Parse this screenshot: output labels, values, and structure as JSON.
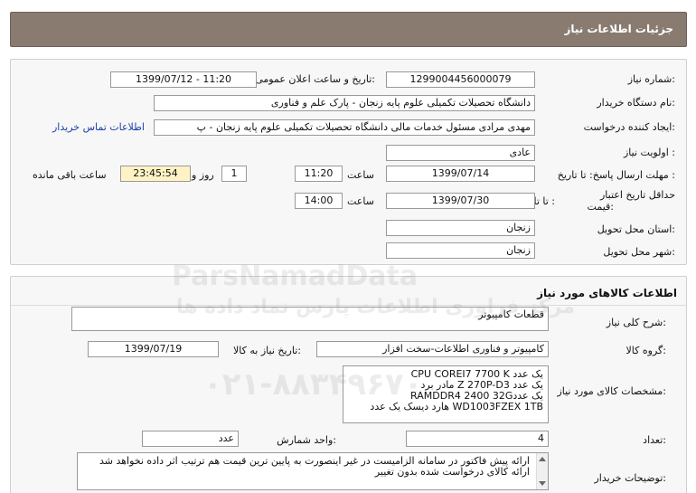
{
  "header": {
    "title": "جزئیات اطلاعات نیاز"
  },
  "form": {
    "need_number_label": "شماره نیاز:",
    "need_number": "1299004456000079",
    "announce_label": "تاریخ و ساعت اعلان عمومی:",
    "announce_value": "1399/07/12 - 11:20",
    "buyer_label": "نام دستگاه خریدار:",
    "buyer_value": "دانشگاه تحصیلات تکمیلی علوم پایه زنجان - پارک علم و فناوری",
    "creator_label": "ایجاد کننده درخواست:",
    "creator_value": "مهدی مرادی مسئول خدمات مالی دانشگاه تحصیلات تکمیلی علوم پایه زنجان - پ",
    "contact_link": "اطلاعات تماس خریدار",
    "priority_label": "اولویت نیاز :",
    "priority_value": "عادی",
    "deadline_label": "مهلت ارسال پاسخ:  تا تاریخ :",
    "deadline_date": "1399/07/14",
    "time_label": "ساعت",
    "deadline_time": "11:20",
    "days_value": "1",
    "days_label": "روز و",
    "remaining_time": "23:45:54",
    "remaining_label": "ساعت باقی مانده",
    "validity_label_1": "حداقل تاریخ اعتبار",
    "validity_label_2": "قیمت:",
    "validity_to_label": "تا تاریخ :",
    "validity_date": "1399/07/30",
    "validity_time_label": "ساعت",
    "validity_time": "14:00",
    "province_label": "استان محل تحویل:",
    "province_value": "زنجان",
    "city_label": "شهر محل تحویل:",
    "city_value": "زنجان"
  },
  "goods": {
    "section_title": "اطلاعات کالاهای مورد نیاز",
    "summary_label": "شرح کلی نیاز:",
    "summary_value": "قطعات کامپیوتر",
    "group_label": "گروه کالا:",
    "group_value": "کامپیوتر و فناوری اطلاعات-سخت افزار",
    "need_date_label": "تاریخ نیاز به کالا:",
    "need_date_value": "1399/07/19",
    "spec_label": "مشخصات کالای مورد نیاز:",
    "spec_lines": "CPU COREI7 7700 K یک عدد\nمادر برد Z 270P-D3 یک عدد\nRAMDDR4 2400 32Gیک عدد\nهارد دیسک  یک عدد WD1003FZEX 1TB",
    "count_label": "تعداد:",
    "count_value": "4",
    "unit_label": "واحد شمارش:",
    "unit_value": "عدد",
    "notes_label": "توضیحات خریدار:",
    "notes_lines": "ارائه پیش فاکتور در سامانه الزامیست در غیر اینصورت به پایین ترین قیمت هم ترتیب اثر داده نخواهد شد\nارائه کالای درخواست شده بدون تغییر"
  },
  "watermark": {
    "brand": "ParsNamadData",
    "tagline": "مرکز فراوری اطلاعات پارس نماد داده ها",
    "phone": "۰۲۱-۸۸۳۴۹۶۷۰"
  }
}
